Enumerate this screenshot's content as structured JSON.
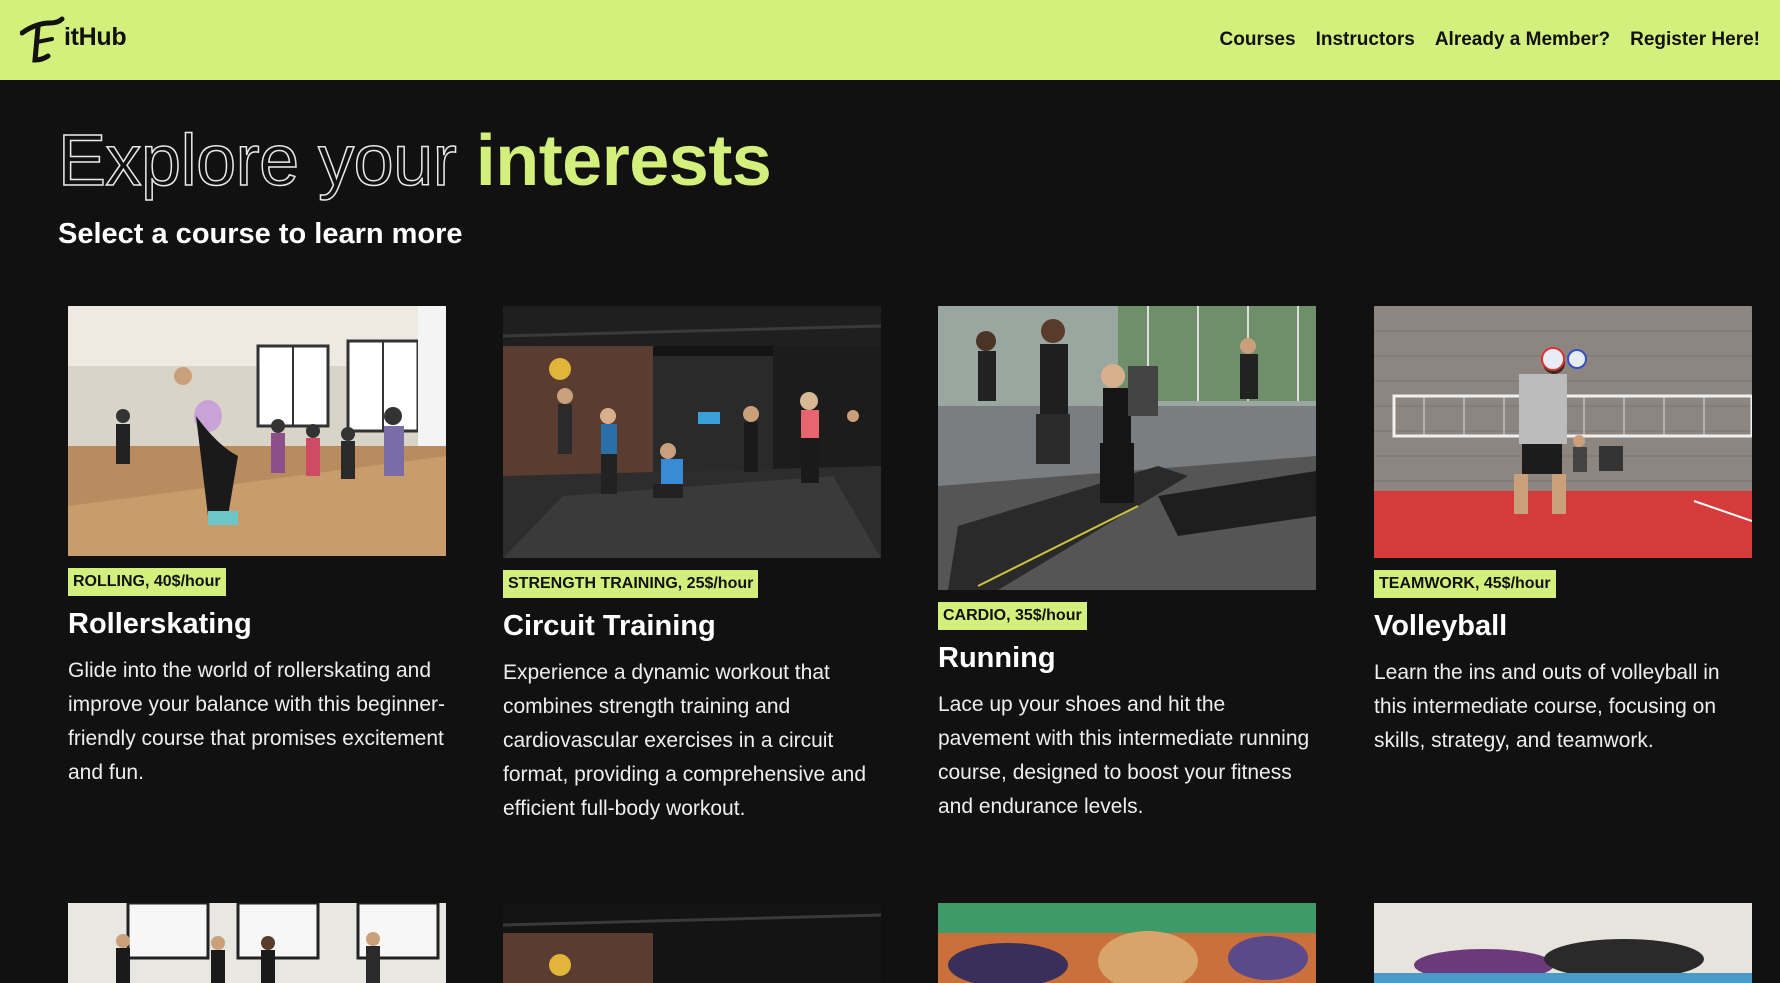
{
  "brand": {
    "name": "itHub"
  },
  "nav": {
    "courses": "Courses",
    "instructors": "Instructors",
    "member": "Already a Member?",
    "register": "Register Here!"
  },
  "hero": {
    "title_outline": "Explore your",
    "title_accent": "interests",
    "subtitle": "Select a course to learn more"
  },
  "colors": {
    "accent": "#d4f07c",
    "background": "#111111",
    "text": "#ffffff"
  },
  "courses": [
    {
      "badge": "ROLLING, 40$/hour",
      "title": "Rollerskating",
      "description": "Glide into the world of rollerskating and improve your balance with this beginner-friendly course that promises excitement and fun."
    },
    {
      "badge": "STRENGTH TRAINING, 25$/hour",
      "title": "Circuit Training",
      "description": "Experience a dynamic workout that combines strength training and cardiovascular exercises in a circuit format, providing a comprehensive and efficient full-body workout."
    },
    {
      "badge": "CARDIO, 35$/hour",
      "title": "Running",
      "description": "Lace up your shoes and hit the pavement with this intermediate running course, designed to boost your fitness and endurance levels."
    },
    {
      "badge": "TEAMWORK, 45$/hour",
      "title": "Volleyball",
      "description": "Learn the ins and outs of volleyball in this intermediate course, focusing on skills, strategy, and teamwork."
    }
  ]
}
